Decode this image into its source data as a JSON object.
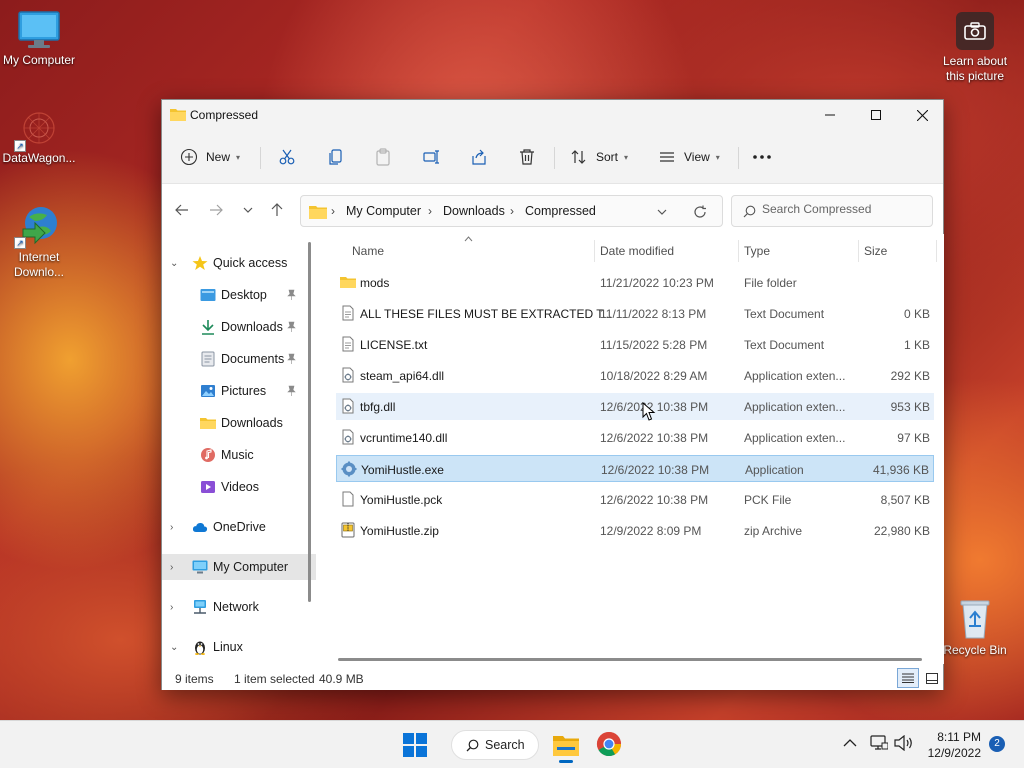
{
  "desktop": {
    "icons": [
      {
        "label": "My Computer",
        "icon": "monitor-icon"
      },
      {
        "label": "DataWagon...",
        "icon": "datawagon-icon"
      },
      {
        "label": "Internet Downlo...",
        "icon": "idm-globe-icon"
      }
    ],
    "learn_about": "Learn about this picture",
    "recycle_bin": "Recycle Bin"
  },
  "window": {
    "title": "Compressed",
    "toolbar": {
      "new_label": "New",
      "sort_label": "Sort",
      "view_label": "View"
    },
    "breadcrumb": [
      "My Computer",
      "Downloads",
      "Compressed"
    ],
    "search_placeholder": "Search Compressed",
    "sidebar": {
      "quick_access": "Quick access",
      "pinned": [
        {
          "label": "Desktop",
          "icon": "desktop-folder-icon",
          "pinned": true
        },
        {
          "label": "Downloads",
          "icon": "downloads-arrow-icon",
          "pinned": true
        },
        {
          "label": "Documents",
          "icon": "documents-icon",
          "pinned": true
        },
        {
          "label": "Pictures",
          "icon": "pictures-icon",
          "pinned": true
        },
        {
          "label": "Downloads",
          "icon": "folder-icon",
          "pinned": false
        },
        {
          "label": "Music",
          "icon": "music-icon",
          "pinned": false
        },
        {
          "label": "Videos",
          "icon": "videos-icon",
          "pinned": false
        }
      ],
      "onedrive": "OneDrive",
      "my_computer": "My Computer",
      "network": "Network",
      "linux": "Linux"
    },
    "columns": {
      "name": "Name",
      "date": "Date modified",
      "type": "Type",
      "size": "Size"
    },
    "files": [
      {
        "name": "mods",
        "date": "11/21/2022 10:23 PM",
        "type": "File folder",
        "size": "",
        "icon": "folder-icon"
      },
      {
        "name": "ALL THESE FILES MUST BE EXTRACTED T...",
        "date": "11/11/2022 8:13 PM",
        "type": "Text Document",
        "size": "0 KB",
        "icon": "text-file-icon"
      },
      {
        "name": "LICENSE.txt",
        "date": "11/15/2022 5:28 PM",
        "type": "Text Document",
        "size": "1 KB",
        "icon": "text-file-icon"
      },
      {
        "name": "steam_api64.dll",
        "date": "10/18/2022 8:29 AM",
        "type": "Application exten...",
        "size": "292 KB",
        "icon": "dll-icon"
      },
      {
        "name": "tbfg.dll",
        "date": "12/6/2022 10:38 PM",
        "type": "Application exten...",
        "size": "953 KB",
        "icon": "dll-icon"
      },
      {
        "name": "vcruntime140.dll",
        "date": "12/6/2022 10:38 PM",
        "type": "Application exten...",
        "size": "97 KB",
        "icon": "dll-icon"
      },
      {
        "name": "YomiHustle.exe",
        "date": "12/6/2022 10:38 PM",
        "type": "Application",
        "size": "41,936 KB",
        "icon": "exe-icon"
      },
      {
        "name": "YomiHustle.pck",
        "date": "12/6/2022 10:38 PM",
        "type": "PCK File",
        "size": "8,507 KB",
        "icon": "blank-file-icon"
      },
      {
        "name": "YomiHustle.zip",
        "date": "12/9/2022 8:09 PM",
        "type": "zip Archive",
        "size": "22,980 KB",
        "icon": "zip-icon"
      }
    ],
    "status": {
      "items": "9 items",
      "selected": "1 item selected",
      "size": "40.9 MB"
    }
  },
  "taskbar": {
    "search_label": "Search",
    "time": "8:11 PM",
    "date": "12/9/2022",
    "notifications": "2"
  },
  "colors": {
    "accent": "#0067c0",
    "selection": "#cce4f7",
    "folder": "#f4c430"
  }
}
